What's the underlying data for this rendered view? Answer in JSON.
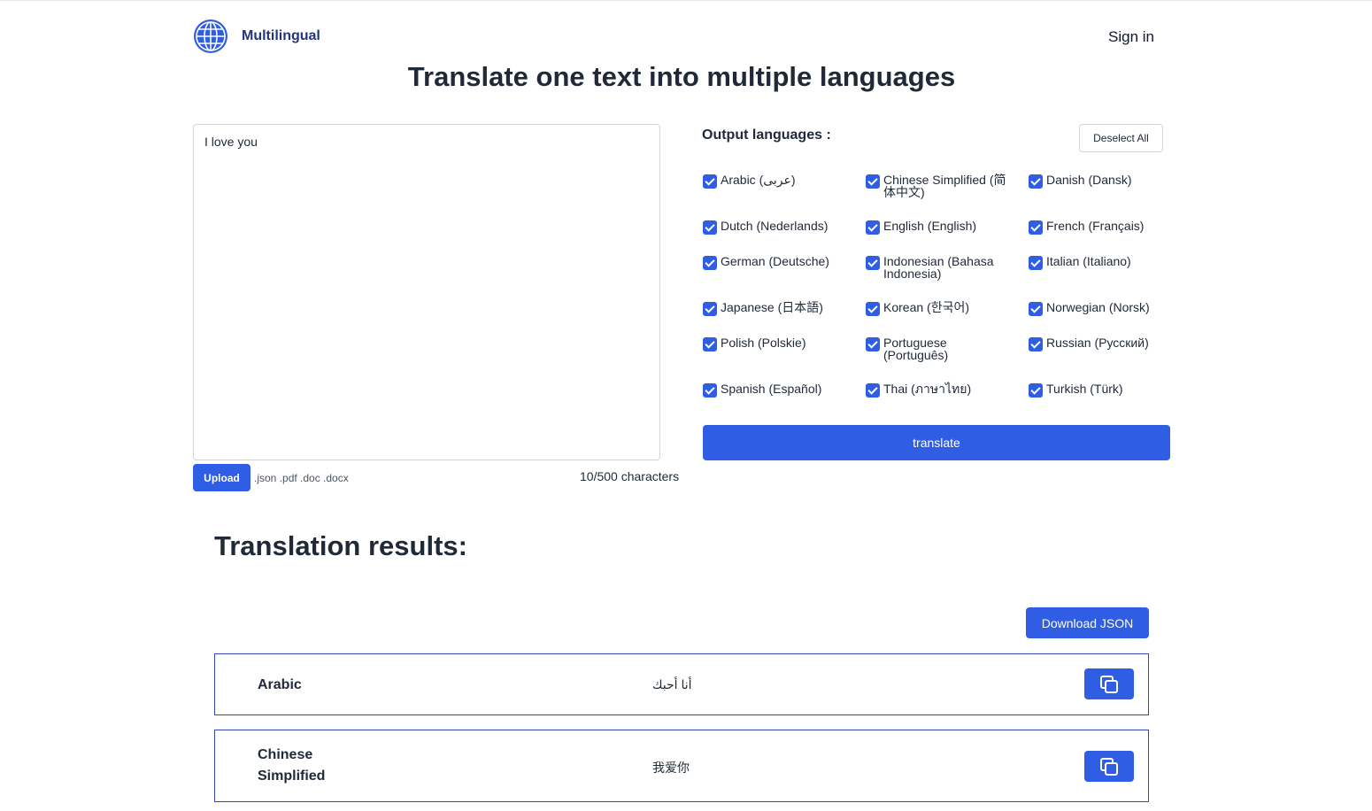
{
  "header": {
    "logo_text": "Multilingual",
    "signin_label": "Sign in"
  },
  "page_title": "Translate one text into multiple languages",
  "input": {
    "text": "I love you",
    "upload_label": "Upload",
    "file_types": ".json .pdf .doc .docx",
    "char_count": "10/500 characters"
  },
  "output": {
    "label": "Output languages :",
    "deselect_label": "Deselect All",
    "languages": [
      {
        "label": "Arabic (عربى)",
        "checked": true
      },
      {
        "label": "Chinese Simplified (简体中文)",
        "checked": true
      },
      {
        "label": "Danish (Dansk)",
        "checked": true
      },
      {
        "label": "Dutch (Nederlands)",
        "checked": true
      },
      {
        "label": "English (English)",
        "checked": true
      },
      {
        "label": "French (Français)",
        "checked": true
      },
      {
        "label": "German (Deutsche)",
        "checked": true
      },
      {
        "label": "Indonesian (Bahasa Indonesia)",
        "checked": true
      },
      {
        "label": "Italian (Italiano)",
        "checked": true
      },
      {
        "label": "Japanese (日本語)",
        "checked": true
      },
      {
        "label": "Korean (한국어)",
        "checked": true
      },
      {
        "label": "Norwegian (Norsk)",
        "checked": true
      },
      {
        "label": "Polish (Polskie)",
        "checked": true
      },
      {
        "label": "Portuguese (Português)",
        "checked": true
      },
      {
        "label": "Russian (Русский)",
        "checked": true
      },
      {
        "label": "Spanish (Español)",
        "checked": true
      },
      {
        "label": "Thai (ภาษาไทย)",
        "checked": true
      },
      {
        "label": "Turkish (Türk)",
        "checked": true
      }
    ],
    "translate_label": "translate"
  },
  "results": {
    "title": "Translation results:",
    "download_label": "Download JSON",
    "items": [
      {
        "language": "Arabic",
        "text": "أنا أحبك"
      },
      {
        "language": "Chinese Simplified",
        "text": "我爱你"
      }
    ]
  },
  "colors": {
    "accent": "#2f5de3",
    "logo_text": "#25357a",
    "row_border": "#2f4ab7"
  },
  "icons": {
    "logo": "globe-icon",
    "checkbox": "checkmark-icon",
    "copy": "copy-icon"
  }
}
